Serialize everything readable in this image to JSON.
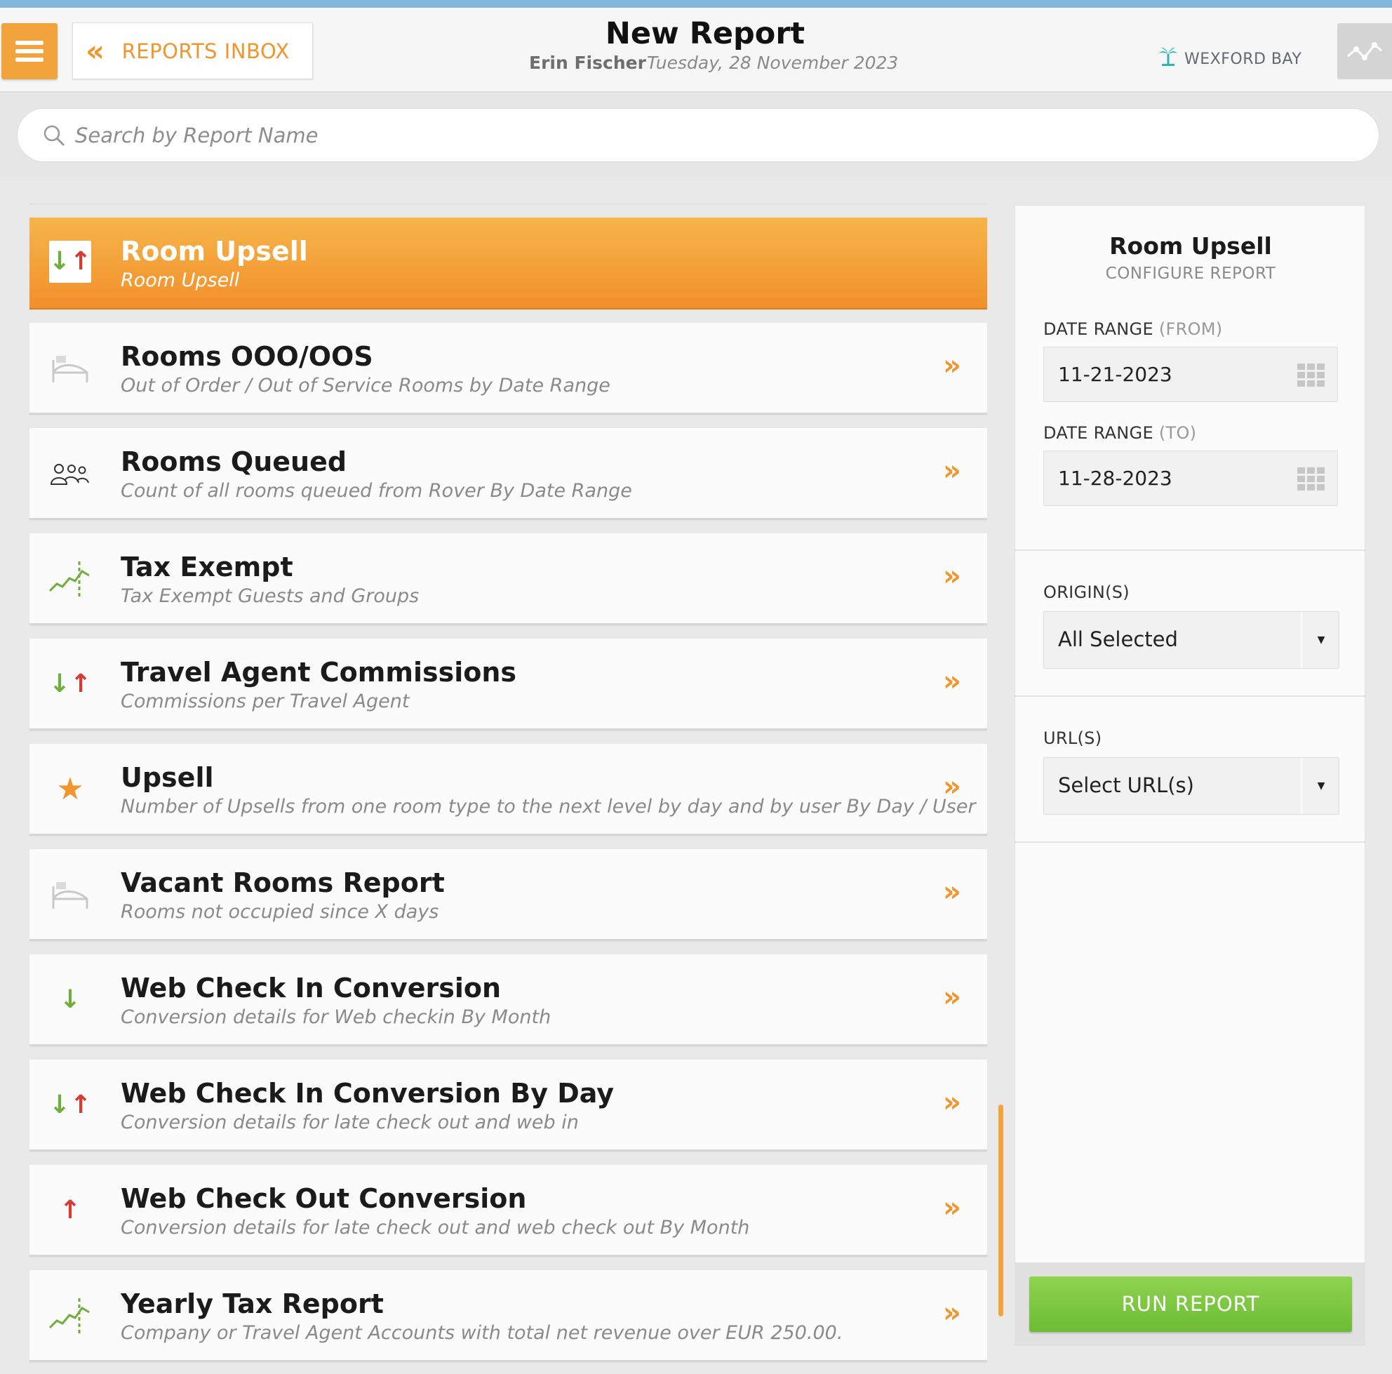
{
  "header": {
    "inbox_label": "REPORTS INBOX",
    "title": "New Report",
    "user": "Erin Fischer",
    "date": "Tuesday, 28 November 2023",
    "hotel": "WEXFORD BAY"
  },
  "search": {
    "placeholder": "Search by Report Name",
    "value": ""
  },
  "reports": [
    {
      "title": "Room Upsell",
      "subtitle": "Room Upsell",
      "icon": "up-down-arrows-icon",
      "active": true
    },
    {
      "title": "Rooms OOO/OOS",
      "subtitle": "Out of Order / Out of Service Rooms by Date Range",
      "icon": "bed-icon"
    },
    {
      "title": "Rooms Queued",
      "subtitle": "Count of all rooms queued from Rover By Date Range",
      "icon": "people-queue-icon"
    },
    {
      "title": "Tax Exempt",
      "subtitle": "Tax Exempt Guests and Groups",
      "icon": "trend-chart-icon"
    },
    {
      "title": "Travel Agent Commissions",
      "subtitle": "Commissions per Travel Agent",
      "icon": "up-down-arrows-icon"
    },
    {
      "title": "Upsell",
      "subtitle": "Number of Upsells from one room type to the next level by day and by user By Day / User",
      "icon": "star-icon"
    },
    {
      "title": "Vacant Rooms Report",
      "subtitle": "Rooms not occupied since X days",
      "icon": "bed-icon"
    },
    {
      "title": "Web Check In Conversion",
      "subtitle": "Conversion details for Web checkin By Month",
      "icon": "down-arrow-icon"
    },
    {
      "title": "Web Check In Conversion By Day",
      "subtitle": "Conversion details for late check out and web in",
      "icon": "up-down-arrows-icon"
    },
    {
      "title": "Web Check Out Conversion",
      "subtitle": "Conversion details for late check out and web check out By Month",
      "icon": "up-arrow-icon"
    },
    {
      "title": "Yearly Tax Report",
      "subtitle": "Company or Travel Agent Accounts with total net revenue over EUR 250.00.",
      "icon": "trend-chart-icon"
    }
  ],
  "panel": {
    "title": "Room Upsell",
    "subtitle": "CONFIGURE REPORT",
    "date_from_label": "DATE RANGE",
    "date_from_hint": "(FROM)",
    "date_from_value": "11-21-2023",
    "date_to_label": "DATE RANGE",
    "date_to_hint": "(TO)",
    "date_to_value": "11-28-2023",
    "origins_label": "ORIGIN(S)",
    "origins_value": "All Selected",
    "urls_label": "URL(S)",
    "urls_value": "Select URL(s)",
    "run_label": "RUN REPORT"
  },
  "colors": {
    "accent": "#f2a33c",
    "run": "#7ac642",
    "arrow_down": "#6fae3b",
    "arrow_up": "#d9392f"
  }
}
